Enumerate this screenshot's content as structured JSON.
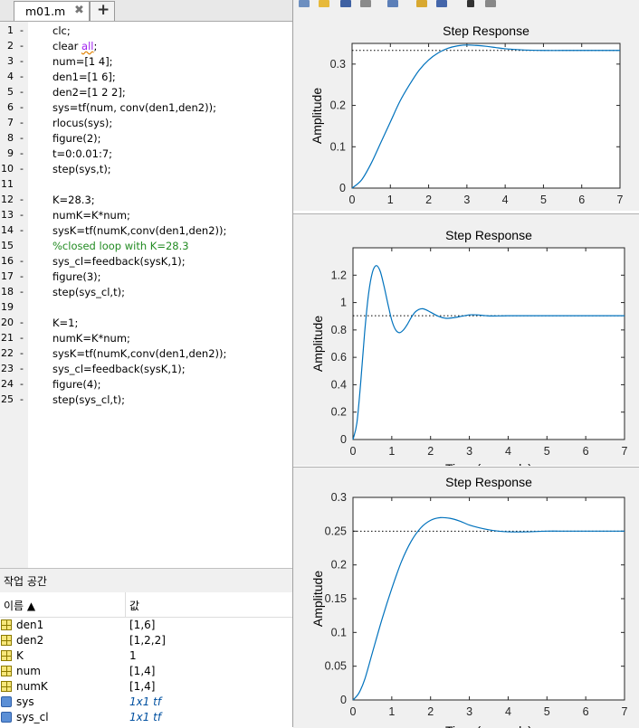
{
  "editor": {
    "tab_label": "m01.m",
    "tab_close": "✖",
    "tab_add": "+",
    "lines": [
      {
        "n": "1",
        "d": "-",
        "t": "clc;"
      },
      {
        "n": "2",
        "d": "-",
        "t": "clear ",
        "kw": "all",
        ";": ";"
      },
      {
        "n": "3",
        "d": "-",
        "t": "num=[1 4];"
      },
      {
        "n": "4",
        "d": "-",
        "t": "den1=[1 6];"
      },
      {
        "n": "5",
        "d": "-",
        "t": "den2=[1 2 2];"
      },
      {
        "n": "6",
        "d": "-",
        "t": "sys=tf(num, conv(den1,den2));"
      },
      {
        "n": "7",
        "d": "-",
        "t": "rlocus(sys);"
      },
      {
        "n": "8",
        "d": "-",
        "t": "figure(2);"
      },
      {
        "n": "9",
        "d": "-",
        "t": "t=0:0.01:7;"
      },
      {
        "n": "10",
        "d": "-",
        "t": "step(sys,t);"
      },
      {
        "n": "11",
        "d": "",
        "t": ""
      },
      {
        "n": "12",
        "d": "-",
        "t": "K=28.3;"
      },
      {
        "n": "13",
        "d": "-",
        "t": "numK=K*num;"
      },
      {
        "n": "14",
        "d": "-",
        "t": "sysK=tf(numK,conv(den1,den2));"
      },
      {
        "n": "15",
        "d": "",
        "t": "%closed loop with K=28.3",
        "comment": true
      },
      {
        "n": "16",
        "d": "-",
        "t": "sys_cl=feedback(sysK,1);"
      },
      {
        "n": "17",
        "d": "-",
        "t": "figure(3);"
      },
      {
        "n": "18",
        "d": "-",
        "t": "step(sys_cl,t);"
      },
      {
        "n": "19",
        "d": "",
        "t": ""
      },
      {
        "n": "20",
        "d": "-",
        "t": "K=1;"
      },
      {
        "n": "21",
        "d": "-",
        "t": "numK=K*num;"
      },
      {
        "n": "22",
        "d": "-",
        "t": "sysK=tf(numK,conv(den1,den2));"
      },
      {
        "n": "23",
        "d": "-",
        "t": "sys_cl=feedback(sysK,1);"
      },
      {
        "n": "24",
        "d": "-",
        "t": "figure(4);"
      },
      {
        "n": "25",
        "d": "-",
        "t": "step(sys_cl,t);"
      }
    ]
  },
  "workspace": {
    "title": "작업 공간",
    "col_name": "이름 ▲",
    "col_value": "값",
    "vars": [
      {
        "name": "den1",
        "value": "[1,6]",
        "icon": "matrix-icon"
      },
      {
        "name": "den2",
        "value": "[1,2,2]",
        "icon": "matrix-icon"
      },
      {
        "name": "K",
        "value": "1",
        "icon": "matrix-icon"
      },
      {
        "name": "num",
        "value": "[1,4]",
        "icon": "matrix-icon"
      },
      {
        "name": "numK",
        "value": "[1,4]",
        "icon": "matrix-icon"
      },
      {
        "name": "sys",
        "value": "1x1 tf",
        "icon": "object-icon",
        "italic": true
      },
      {
        "name": "sys_cl",
        "value": "1x1 tf",
        "icon": "object-icon",
        "italic": true
      }
    ]
  },
  "chart_data": [
    {
      "type": "line",
      "title": "Step Response",
      "ylabel": "Amplitude",
      "xlabel": "",
      "xlim": [
        0,
        7
      ],
      "ylim": [
        0,
        0.35
      ],
      "xticks": [
        "0",
        "1",
        "2",
        "3",
        "4",
        "5",
        "6",
        "7"
      ],
      "yticks": [
        "0",
        "0.1",
        "0.2",
        "0.3"
      ],
      "yticks_values": [
        0,
        0.1,
        0.2,
        0.3
      ],
      "steady_state": 0.333,
      "series": [
        {
          "x": [
            0,
            0.25,
            0.5,
            0.75,
            1,
            1.25,
            1.5,
            1.75,
            2,
            2.25,
            2.5,
            2.75,
            3,
            3.25,
            3.5,
            3.75,
            4,
            4.5,
            5,
            5.5,
            6,
            6.5,
            7
          ],
          "y": [
            0,
            0.02,
            0.06,
            0.11,
            0.16,
            0.21,
            0.25,
            0.285,
            0.31,
            0.327,
            0.338,
            0.344,
            0.346,
            0.345,
            0.343,
            0.34,
            0.337,
            0.334,
            0.333,
            0.333,
            0.333,
            0.333,
            0.333
          ]
        }
      ]
    },
    {
      "type": "line",
      "title": "Step Response",
      "ylabel": "Amplitude",
      "xlabel": "Time (seconds)",
      "xlim": [
        0,
        7
      ],
      "ylim": [
        0,
        1.4
      ],
      "xticks": [
        "0",
        "1",
        "2",
        "3",
        "4",
        "5",
        "6",
        "7"
      ],
      "yticks": [
        "0",
        "0.2",
        "0.4",
        "0.6",
        "0.8",
        "1",
        "1.2"
      ],
      "yticks_values": [
        0,
        0.2,
        0.4,
        0.6,
        0.8,
        1,
        1.2
      ],
      "steady_state": 0.904,
      "series": [
        {
          "x": [
            0,
            0.1,
            0.2,
            0.3,
            0.4,
            0.5,
            0.6,
            0.7,
            0.8,
            0.9,
            1.0,
            1.1,
            1.2,
            1.3,
            1.4,
            1.5,
            1.6,
            1.7,
            1.8,
            1.9,
            2.0,
            2.2,
            2.4,
            2.6,
            2.8,
            3.0,
            3.2,
            3.4,
            3.6,
            4,
            5,
            6,
            7
          ],
          "y": [
            0,
            0.12,
            0.42,
            0.78,
            1.06,
            1.22,
            1.27,
            1.23,
            1.12,
            0.99,
            0.87,
            0.8,
            0.78,
            0.8,
            0.84,
            0.89,
            0.93,
            0.95,
            0.955,
            0.945,
            0.93,
            0.9,
            0.885,
            0.89,
            0.9,
            0.91,
            0.91,
            0.905,
            0.902,
            0.904,
            0.904,
            0.904,
            0.904
          ]
        }
      ]
    },
    {
      "type": "line",
      "title": "Step Response",
      "ylabel": "Amplitude",
      "xlabel": "Time (seconds)",
      "xlim": [
        0,
        7
      ],
      "ylim": [
        0,
        0.3
      ],
      "xticks": [
        "0",
        "1",
        "2",
        "3",
        "4",
        "5",
        "6",
        "7"
      ],
      "yticks": [
        "0",
        "0.05",
        "0.1",
        "0.15",
        "0.2",
        "0.25",
        "0.3"
      ],
      "yticks_values": [
        0,
        0.05,
        0.1,
        0.15,
        0.2,
        0.25,
        0.3
      ],
      "steady_state": 0.25,
      "series": [
        {
          "x": [
            0,
            0.15,
            0.3,
            0.5,
            0.75,
            1,
            1.25,
            1.5,
            1.75,
            2,
            2.25,
            2.5,
            2.75,
            3,
            3.25,
            3.5,
            3.75,
            4,
            4.5,
            5,
            5.5,
            6,
            6.5,
            7
          ],
          "y": [
            0,
            0.01,
            0.03,
            0.07,
            0.12,
            0.165,
            0.205,
            0.235,
            0.255,
            0.266,
            0.27,
            0.269,
            0.265,
            0.259,
            0.255,
            0.252,
            0.25,
            0.249,
            0.249,
            0.25,
            0.25,
            0.25,
            0.25,
            0.25
          ]
        }
      ]
    }
  ]
}
